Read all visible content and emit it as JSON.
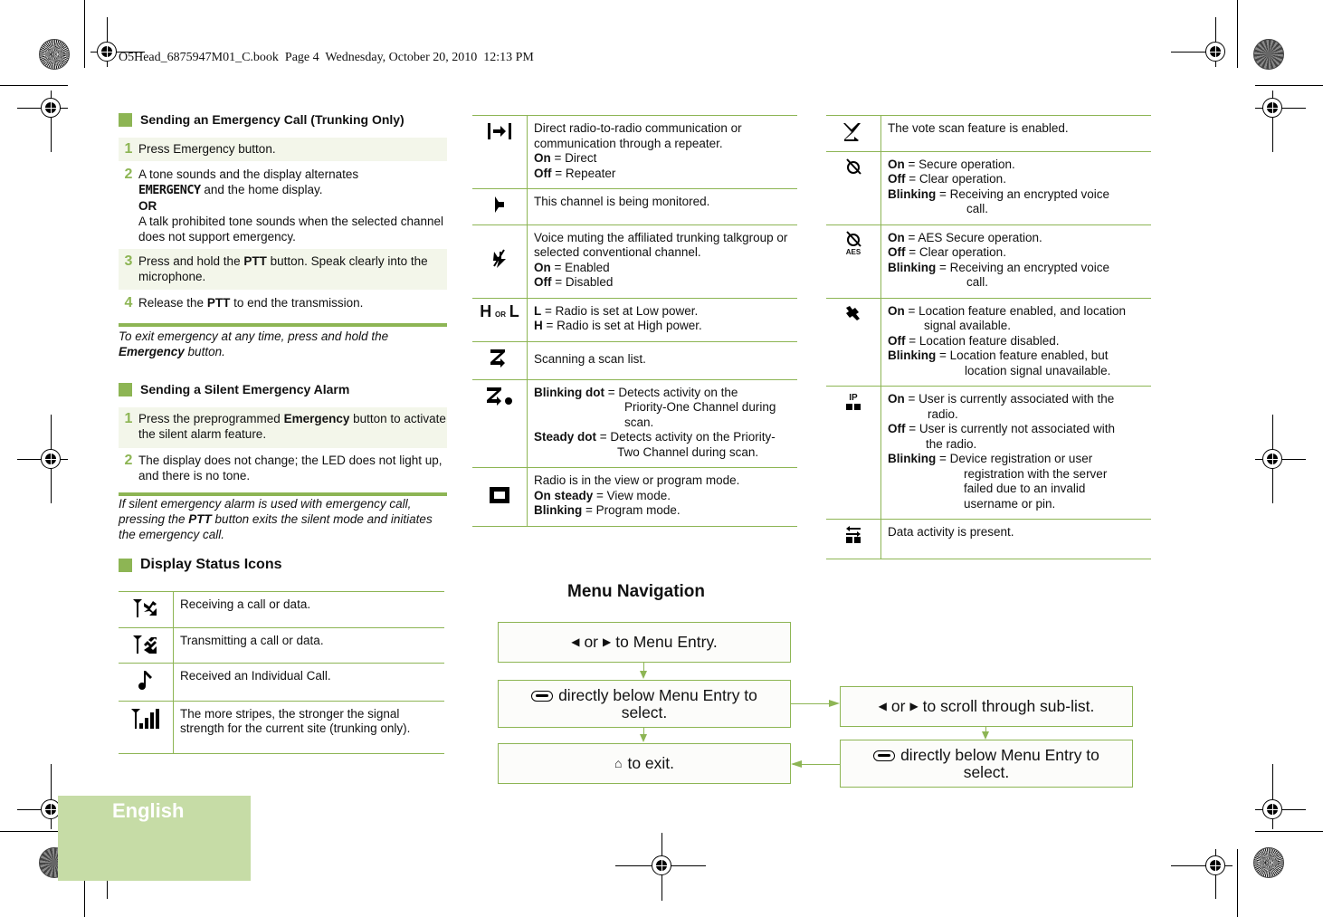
{
  "print_header": "O5Head_6875947M01_C.book  Page 4  Wednesday, October 20, 2010  12:13 PM",
  "language_tab": "English",
  "colors": {
    "accent_green": "#8db554",
    "row_shade": "#f3f6ea",
    "tab_green": "#c6dca6"
  },
  "emergency": {
    "title": "Sending an Emergency Call (Trunking Only)",
    "steps": [
      {
        "num": "1",
        "text": "Press Emergency button."
      },
      {
        "num": "2",
        "text_a": "A tone sounds and the display alternates",
        "lcd": "EMERGENCY",
        "text_b": " and the home display.",
        "or": "OR",
        "text_c": "A talk prohibited tone sounds when the selected channel does not support emergency."
      },
      {
        "num": "3",
        "pre": "Press and hold the ",
        "bold": "PTT",
        "post": " button. Speak clearly into the microphone."
      },
      {
        "num": "4",
        "pre": "Release the ",
        "bold": "PTT",
        "post": " to end the transmission."
      }
    ],
    "note_pre": "To exit emergency at any time, press and hold the ",
    "note_bold": "Emergency",
    "note_post": " button."
  },
  "silent": {
    "title": "Sending a Silent Emergency Alarm",
    "steps": [
      {
        "num": "1",
        "pre": "Press the preprogrammed ",
        "bold": "Emergency",
        "post": " button to activate the silent alarm feature."
      },
      {
        "num": "2",
        "text": "The display does not change; the LED does not light up, and there is no tone."
      }
    ],
    "note_pre": "If silent emergency alarm is used with emergency call, pressing the ",
    "note_bold": "PTT",
    "note_post": " button exits the silent mode and initiates the emergency call."
  },
  "status_icons": {
    "title": "Display Status Icons",
    "col1": [
      {
        "icon": "receiving-icon",
        "text": "Receiving a call or data."
      },
      {
        "icon": "transmitting-icon",
        "text": "Transmitting a call or data."
      },
      {
        "icon": "individual-call-icon",
        "text": "Received an Individual Call."
      },
      {
        "icon": "signal-strength-icon",
        "text": "The more stripes, the stronger the signal strength for the current site (trunking only)."
      }
    ],
    "col2": [
      {
        "icon": "talkaround-icon",
        "text": "Direct radio-to-radio communication or communication through a repeater.",
        "lines": [
          {
            "b": "On",
            "t": " = Direct"
          },
          {
            "b": "Off",
            "t": " = Repeater"
          }
        ]
      },
      {
        "icon": "monitor-icon",
        "text": "This channel is being monitored.",
        "lines": []
      },
      {
        "icon": "mute-icon",
        "text": "Voice muting the affiliated trunking talkgroup or selected conventional channel.",
        "lines": [
          {
            "b": "On",
            "t": " = Enabled"
          },
          {
            "b": "Off",
            "t": " = Disabled"
          }
        ]
      },
      {
        "icon": "power-level-icon",
        "icon_or": "OR",
        "text": "",
        "lines": [
          {
            "b": "L",
            "t": " = Radio is set at Low power."
          },
          {
            "b": "H",
            "t": " = Radio is set at High power."
          }
        ]
      },
      {
        "icon": "scan-icon",
        "text": "Scanning a scan list.",
        "lines": []
      },
      {
        "icon": "priority-scan-icon",
        "text": "",
        "lines": [
          {
            "b": "Blinking dot",
            "t": " = Detects activity on the",
            "cont": "Priority-One Channel during scan."
          },
          {
            "b": "Steady dot",
            "t": " = Detects activity on the Priority-",
            "cont": "Two Channel during scan."
          }
        ]
      },
      {
        "icon": "view-program-mode-icon",
        "text": "Radio is in the view or program mode.",
        "lines": [
          {
            "b": "On steady",
            "t": " = View mode."
          },
          {
            "b": "Blinking",
            "t": " = Program mode."
          }
        ]
      }
    ],
    "col3": [
      {
        "icon": "vote-scan-icon",
        "text": "The vote scan feature is enabled.",
        "lines": []
      },
      {
        "icon": "secure-icon",
        "text": "",
        "lines": [
          {
            "b": "On",
            "t": " = Secure operation."
          },
          {
            "b": "Off",
            "t": " = Clear operation."
          },
          {
            "b": "Blinking",
            "t": " = Receiving an encrypted voice",
            "cont": "call."
          }
        ]
      },
      {
        "icon": "aes-secure-icon",
        "icon_label": "AES",
        "text": "",
        "lines": [
          {
            "b": "On",
            "t": " = AES Secure operation."
          },
          {
            "b": "Off",
            "t": " = Clear operation."
          },
          {
            "b": "Blinking",
            "t": " = Receiving an encrypted voice",
            "cont": "call."
          }
        ]
      },
      {
        "icon": "gps-icon",
        "text": "",
        "lines": [
          {
            "b": "On",
            "t": " = Location feature enabled, and location",
            "cont": "signal available."
          },
          {
            "b": "Off",
            "t": " = Location feature disabled."
          },
          {
            "b": "Blinking",
            "t": " = Location feature enabled, but",
            "cont": "location signal unavailable."
          }
        ]
      },
      {
        "icon": "ip-user-icon",
        "icon_label": "IP",
        "text": "",
        "lines": [
          {
            "b": "On",
            "t": " = User is currently associated with the",
            "cont": "radio."
          },
          {
            "b": "Off",
            "t": " = User is currently not associated with",
            "cont": "the radio."
          },
          {
            "b": "Blinking",
            "t": " = Device registration or user",
            "cont": "registration with the server failed due to an invalid username or pin."
          }
        ]
      },
      {
        "icon": "data-activity-icon",
        "text": "Data activity is present.",
        "lines": []
      }
    ]
  },
  "menu_nav": {
    "title": "Menu Navigation",
    "box1": {
      "or": "or",
      "text": "to Menu Entry."
    },
    "box2": {
      "text": "directly below Menu Entry to select."
    },
    "box3": {
      "text": "to exit."
    },
    "box4": {
      "or": "or",
      "text": "to scroll through sub-list."
    },
    "box5": {
      "text": "directly below Menu Entry to select."
    }
  }
}
